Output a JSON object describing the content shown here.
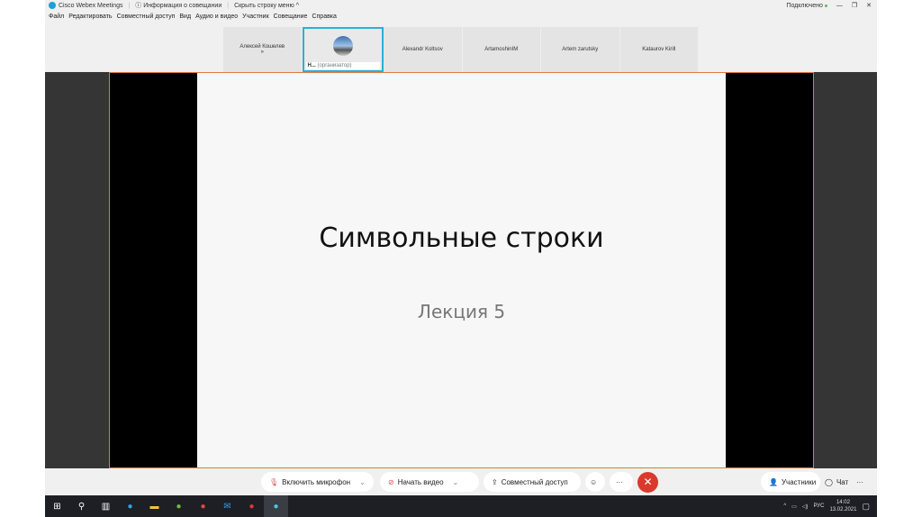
{
  "titlebar": {
    "app": "Cisco Webex Meetings",
    "info": "Информация о совещании",
    "hide_menu": "Скрыть строку меню ^",
    "status": "Подключено"
  },
  "menu": [
    "Файл",
    "Редактировать",
    "Совместный доступ",
    "Вид",
    "Аудио и видео",
    "Участник",
    "Совещание",
    "Справка"
  ],
  "participants": [
    {
      "name": "Алексей Кошелев",
      "sub": "»"
    },
    {
      "name": "Н...",
      "role": "(организатор)"
    },
    {
      "name": "Alexandr Koltsov"
    },
    {
      "name": "ArtamoshinIM"
    },
    {
      "name": "Artem zarutsky"
    },
    {
      "name": "Kataurov Kirill"
    }
  ],
  "slide": {
    "title": "Символьные строки",
    "subtitle": "Лекция 5"
  },
  "controls": {
    "mic": "Включить микрофон",
    "video": "Начать видео",
    "share": "Совместный доступ",
    "participants": "Участники",
    "chat": "Чат"
  },
  "tray": {
    "lang": "РУС",
    "time": "14:02",
    "date": "13.02.2021"
  }
}
